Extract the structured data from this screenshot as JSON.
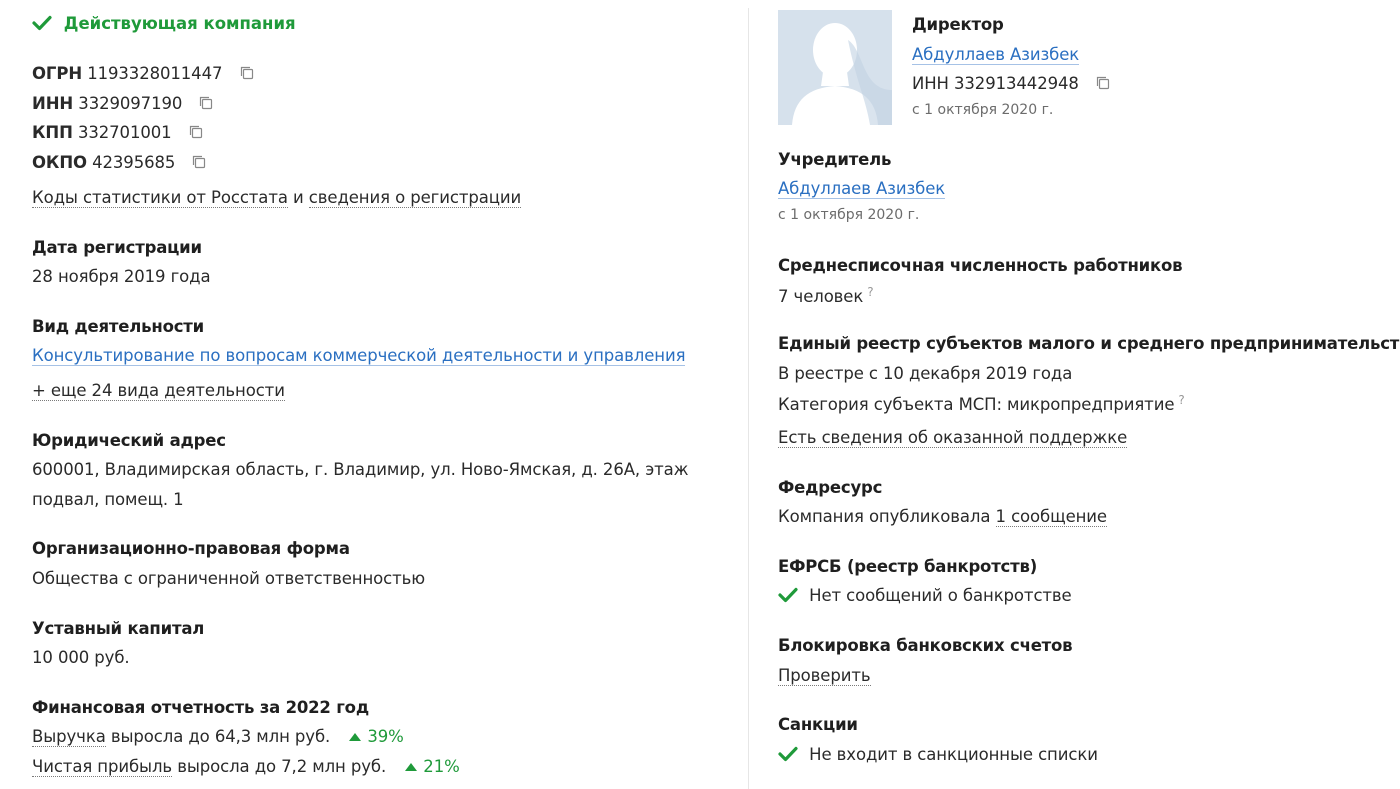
{
  "status": {
    "label": "Действующая компания"
  },
  "codes": [
    {
      "label": "ОГРН",
      "value": "1193328011447"
    },
    {
      "label": "ИНН",
      "value": "3329097190"
    },
    {
      "label": "КПП",
      "value": "332701001"
    },
    {
      "label": "ОКПО",
      "value": "42395685"
    }
  ],
  "stats_links": {
    "rosstat": "Коды статистики от Росстата",
    "and": "и",
    "registration": "сведения о регистрации"
  },
  "registration": {
    "title": "Дата регистрации",
    "value": "28 ноября 2019 года"
  },
  "activity": {
    "title": "Вид деятельности",
    "main": "Консультирование по вопросам коммерческой деятельности и управления",
    "more": "+ еще 24 вида деятельности"
  },
  "address": {
    "title": "Юридический адрес",
    "line1": "600001, Владимирская область, г. Владимир, ул. Ново-Ямская, д. 26А, этаж",
    "line2": "подвал, помещ. 1"
  },
  "legal_form": {
    "title": "Организационно-правовая форма",
    "value": "Общества с ограниченной ответственностью"
  },
  "capital": {
    "title": "Уставный капитал",
    "value": "10 000 руб."
  },
  "finance": {
    "title": "Финансовая отчетность за 2022 год",
    "revenue": {
      "link": "Выручка",
      "text": "выросла до 64,3 млн руб.",
      "change": "39%"
    },
    "profit": {
      "link": "Чистая прибыль",
      "text": "выросла до 7,2 млн руб.",
      "change": "21%"
    }
  },
  "director": {
    "title": "Директор",
    "name": "Абдуллаев Азизбек",
    "inn_label": "ИНН",
    "inn": "332913442948",
    "since": "с 1 октября 2020 г."
  },
  "founder": {
    "title": "Учредитель",
    "name": "Абдуллаев Азизбек",
    "since": "с 1 октября 2020 г."
  },
  "employees": {
    "title": "Среднесписочная численность работников",
    "value": "7 человек",
    "hint": "?"
  },
  "msp": {
    "title": "Единый реестр субъектов малого и среднего предпринимательства",
    "since": "В реестре с 10 декабря 2019 года",
    "category": "Категория субъекта МСП: микропредприятие",
    "hint": "?",
    "support": "Есть сведения об оказанной поддержке"
  },
  "fedresurs": {
    "title": "Федресурс",
    "text": "Компания опубликовала",
    "link": "1 сообщение"
  },
  "efrsb": {
    "title": "ЕФРСБ (реестр банкротств)",
    "text": "Нет сообщений о банкротстве"
  },
  "bank_block": {
    "title": "Блокировка банковских счетов",
    "link": "Проверить"
  },
  "sanctions": {
    "title": "Санкции",
    "text": "Не входит в санкционные списки"
  },
  "colors": {
    "green": "#1f9a3a",
    "link": "#2a6fc1",
    "avatar_bg": "#d6e1ec"
  },
  "icons": [
    "check-icon",
    "copy-icon",
    "arrow-up-icon",
    "question-icon",
    "avatar-silhouette-icon"
  ]
}
